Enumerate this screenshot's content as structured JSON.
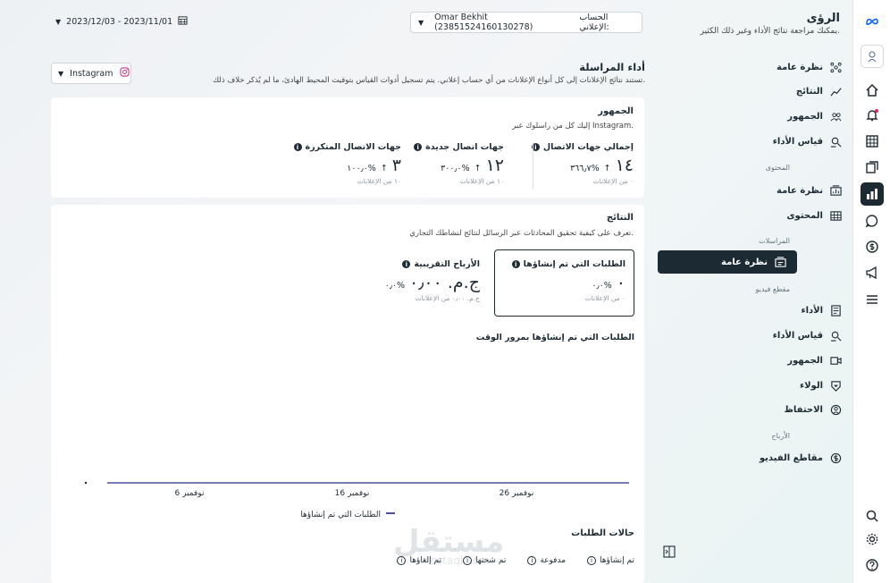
{
  "colors": {
    "accent": "#1c2b33",
    "chart_line": "#4a4fa0",
    "meta_blue": "#0866ff",
    "notification": "#e0245e"
  },
  "header": {
    "app_title": "الرؤى",
    "app_subtitle": "يمكنك مراجعة نتائج الأداء وغير ذلك الكثير.",
    "date_range": "2023/12/03 - 2023/11/01",
    "account_label": "الحساب الإعلاني:",
    "account_value": "Omar Bekhit (238515241601302​78)"
  },
  "sidebar": {
    "items_top": [
      {
        "label": "نظرة عامة",
        "icon": "nodes-icon"
      },
      {
        "label": "النتائج",
        "icon": "trend-icon"
      },
      {
        "label": "الجمهور",
        "icon": "people-icon"
      },
      {
        "label": "قياس الأداء",
        "icon": "measure-icon"
      }
    ],
    "section_content": "المحتوى",
    "items_content": [
      {
        "label": "نظرة عامة",
        "icon": "content-overview-icon"
      },
      {
        "label": "المحتوى",
        "icon": "grid-icon"
      }
    ],
    "section_messages": "المراسلات",
    "items_messages": [
      {
        "label": "نظرة عامة",
        "icon": "message-overview-icon",
        "active": true
      }
    ],
    "section_video": "مقطع فيديو",
    "items_video": [
      {
        "label": "الأداء",
        "icon": "performance-icon"
      },
      {
        "label": "قياس الأداء",
        "icon": "measure-icon"
      },
      {
        "label": "الجمهور",
        "icon": "video-icon"
      },
      {
        "label": "الولاء",
        "icon": "shield-icon"
      },
      {
        "label": "الاحتفاظ",
        "icon": "retention-icon"
      }
    ],
    "section_earnings": "الأرباح",
    "items_earnings": [
      {
        "label": "مقاطع الفيديو",
        "icon": "dollar-icon"
      }
    ]
  },
  "page": {
    "title": "أداء المراسلة",
    "description": "تستند نتائج الإعلانات إلى كل أنواع الإعلانات من أي حساب إعلاني. يتم تسجيل أدوات القياس بتوقيت المحيط الهادئ، ما لم يُذكر خلاف ذلك.",
    "platform": "Instagram"
  },
  "audience": {
    "title": "الجمهور",
    "description": "إليك كل من راسلوك عبر Instagram.",
    "metrics": [
      {
        "label": "إجمالي جهات الاتصال",
        "value": "١٤",
        "change": "٣٦٦٫٧%",
        "note": "٠ من الإعلانات"
      },
      {
        "label": "جهات اتصال جديدة",
        "value": "١٢",
        "change": "٣٠٠٫٠%",
        "note": "١٠ من الإعلانات"
      },
      {
        "label": "جهات الاتصال المتكررة",
        "value": "٣",
        "change": "١٠٠٫٠%",
        "note": "١٠ من الإعلانات"
      }
    ]
  },
  "results": {
    "title": "النتائج",
    "description": "تعرف على كيفية تحقيق المحادثات عبر الرسائل لنتائج لنشاطك التجاري.",
    "box1": {
      "label": "الطلبات التي تم إنشاؤها",
      "value": "٠",
      "change": "٠٫٠%",
      "note": "٠ من الإعلانات"
    },
    "box2": {
      "label": "الأرباح التقريبية",
      "value": "ج.م.‏ ٠٫٠٠",
      "change": "٠٫٠%",
      "note": "ج.م.‏ ٠٫٠٠ من الإعلانات"
    },
    "chart_title": "الطلبات التي تم إنشاؤها بمرور الوقت",
    "legend": "الطلبات التي تم إنشاؤها"
  },
  "chart_data": {
    "type": "line",
    "categories": [
      "6 نوفمبر",
      "16 نوفمبر",
      "26 نوفمبر"
    ],
    "x": [
      "2023-11-01",
      "2023-12-03"
    ],
    "series": [
      {
        "name": "الطلبات التي تم إنشاؤها",
        "values": [
          0,
          0
        ]
      }
    ],
    "ylim": [
      0,
      1
    ],
    "legend": "bottom"
  },
  "order_status": {
    "title": "حالات الطلبات",
    "items": [
      "تم إنشاؤها",
      "مدفوعة",
      "تم شحنها",
      "تم إلغاؤها"
    ]
  },
  "watermark": {
    "text": "مستقل",
    "sub": "mostaql.com"
  }
}
